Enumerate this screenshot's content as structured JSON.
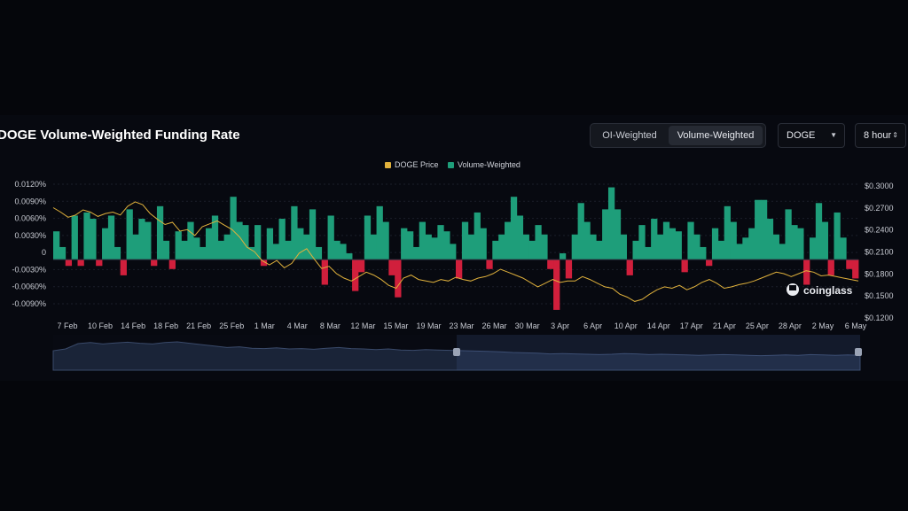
{
  "header": {
    "title": "DOGE Volume-Weighted Funding Rate",
    "toggle": {
      "options": [
        "OI-Weighted",
        "Volume-Weighted"
      ],
      "selected": "Volume-Weighted"
    },
    "coin_select": "DOGE",
    "interval_select": "8 hour"
  },
  "watermark": "coinglass",
  "colors": {
    "positive": "#1e9e7a",
    "negative": "#d11f3c",
    "price_line": "#e0b13c",
    "background": "#070910",
    "navigator": "#1a2438"
  },
  "chart_data": {
    "type": "area",
    "legend": [
      {
        "name": "DOGE Price",
        "color": "#e0b13c"
      },
      {
        "name": "Volume-Weighted",
        "color": "#1e9e7a"
      }
    ],
    "x_tick_labels": [
      "7 Feb",
      "10 Feb",
      "14 Feb",
      "18 Feb",
      "21 Feb",
      "25 Feb",
      "1 Mar",
      "4 Mar",
      "8 Mar",
      "12 Mar",
      "15 Mar",
      "19 Mar",
      "23 Mar",
      "26 Mar",
      "30 Mar",
      "3 Apr",
      "6 Apr",
      "10 Apr",
      "14 Apr",
      "17 Apr",
      "21 Apr",
      "25 Apr",
      "28 Apr",
      "2 May",
      "6 May"
    ],
    "y_left_tick_labels": [
      "0.0120%",
      "0.0090%",
      "0.0060%",
      "0.0030%",
      "0",
      "-0.0030%",
      "-0.0060%",
      "-0.0090%"
    ],
    "y_left_range": [
      -0.009,
      0.012
    ],
    "y_right_tick_labels": [
      "$0.3000",
      "$0.2700",
      "$0.2400",
      "$0.2100",
      "$0.1800",
      "$0.1500",
      "$0.1200"
    ],
    "y_right_range": [
      0.12,
      0.3
    ],
    "series": [
      {
        "name": "Volume-Weighted",
        "axis": "left",
        "unit": "%",
        "values": [
          0.0045,
          0.002,
          -0.001,
          0.007,
          -0.001,
          0.0075,
          0.0065,
          -0.001,
          0.005,
          0.007,
          0.002,
          -0.0025,
          0.008,
          0.004,
          0.0065,
          0.006,
          -0.001,
          0.0085,
          0.003,
          -0.0015,
          0.0045,
          0.003,
          0.006,
          0.0035,
          0.002,
          0.005,
          0.007,
          0.003,
          0.004,
          0.01,
          0.006,
          0.0055,
          0.002,
          0.0055,
          -0.001,
          0.005,
          0.0025,
          0.0065,
          0.003,
          0.0085,
          0.005,
          0.004,
          0.008,
          0.002,
          -0.004,
          0.007,
          0.003,
          0.0025,
          0.001,
          -0.005,
          -0.002,
          0.007,
          0.004,
          0.0085,
          0.006,
          -0.0025,
          -0.006,
          0.005,
          0.0045,
          0.002,
          0.006,
          0.004,
          0.0035,
          0.0055,
          0.0045,
          0.0025,
          -0.003,
          0.006,
          0.004,
          0.0075,
          0.005,
          -0.0015,
          0.003,
          0.004,
          0.006,
          0.01,
          0.007,
          0.004,
          0.003,
          0.0055,
          0.004,
          -0.0015,
          -0.008,
          0.001,
          -0.003,
          0.004,
          0.009,
          0.006,
          0.004,
          0.003,
          0.008,
          0.0115,
          0.008,
          0.004,
          -0.0025,
          0.003,
          0.0055,
          0.002,
          0.0065,
          0.004,
          0.006,
          0.005,
          0.0045,
          -0.002,
          0.006,
          0.004,
          0.002,
          -0.001,
          0.005,
          0.003,
          0.0085,
          0.006,
          0.0025,
          0.0035,
          0.005,
          0.0095,
          0.0095,
          0.0065,
          0.004,
          0.0025,
          0.008,
          0.0055,
          0.005,
          -0.004,
          0.0035,
          0.009,
          0.006,
          -0.0025,
          0.0075,
          0.0035,
          -0.0015,
          -0.003
        ]
      },
      {
        "name": "DOGE Price",
        "axis": "right",
        "unit": "USD",
        "values": [
          0.268,
          0.262,
          0.255,
          0.258,
          0.265,
          0.262,
          0.256,
          0.26,
          0.262,
          0.258,
          0.27,
          0.276,
          0.272,
          0.26,
          0.252,
          0.245,
          0.248,
          0.236,
          0.238,
          0.23,
          0.242,
          0.246,
          0.25,
          0.244,
          0.238,
          0.228,
          0.214,
          0.208,
          0.196,
          0.19,
          0.196,
          0.186,
          0.192,
          0.206,
          0.212,
          0.198,
          0.185,
          0.188,
          0.178,
          0.172,
          0.168,
          0.174,
          0.18,
          0.176,
          0.17,
          0.162,
          0.158,
          0.172,
          0.176,
          0.17,
          0.168,
          0.166,
          0.17,
          0.168,
          0.173,
          0.17,
          0.168,
          0.172,
          0.174,
          0.178,
          0.184,
          0.18,
          0.176,
          0.172,
          0.166,
          0.16,
          0.165,
          0.17,
          0.166,
          0.168,
          0.168,
          0.174,
          0.17,
          0.165,
          0.16,
          0.158,
          0.15,
          0.146,
          0.14,
          0.143,
          0.15,
          0.156,
          0.16,
          0.158,
          0.162,
          0.156,
          0.16,
          0.166,
          0.17,
          0.165,
          0.158,
          0.16,
          0.163,
          0.165,
          0.168,
          0.172,
          0.176,
          0.18,
          0.178,
          0.174,
          0.178,
          0.182,
          0.18,
          0.175,
          0.176,
          0.174,
          0.172,
          0.17,
          0.168
        ]
      }
    ],
    "navigator": {
      "values": [
        0.55,
        0.6,
        0.75,
        0.78,
        0.74,
        0.77,
        0.79,
        0.76,
        0.74,
        0.78,
        0.8,
        0.76,
        0.72,
        0.68,
        0.64,
        0.66,
        0.62,
        0.61,
        0.63,
        0.6,
        0.61,
        0.59,
        0.62,
        0.64,
        0.61,
        0.6,
        0.58,
        0.6,
        0.57,
        0.56,
        0.58,
        0.57,
        0.56,
        0.55,
        0.54,
        0.53,
        0.52,
        0.5,
        0.49,
        0.48,
        0.46,
        0.47,
        0.46,
        0.45,
        0.44,
        0.45,
        0.47,
        0.46,
        0.44,
        0.45,
        0.44,
        0.43,
        0.42,
        0.43,
        0.44,
        0.43,
        0.42,
        0.41,
        0.42,
        0.43,
        0.42,
        0.44,
        0.43,
        0.42,
        0.43,
        0.42
      ]
    }
  }
}
